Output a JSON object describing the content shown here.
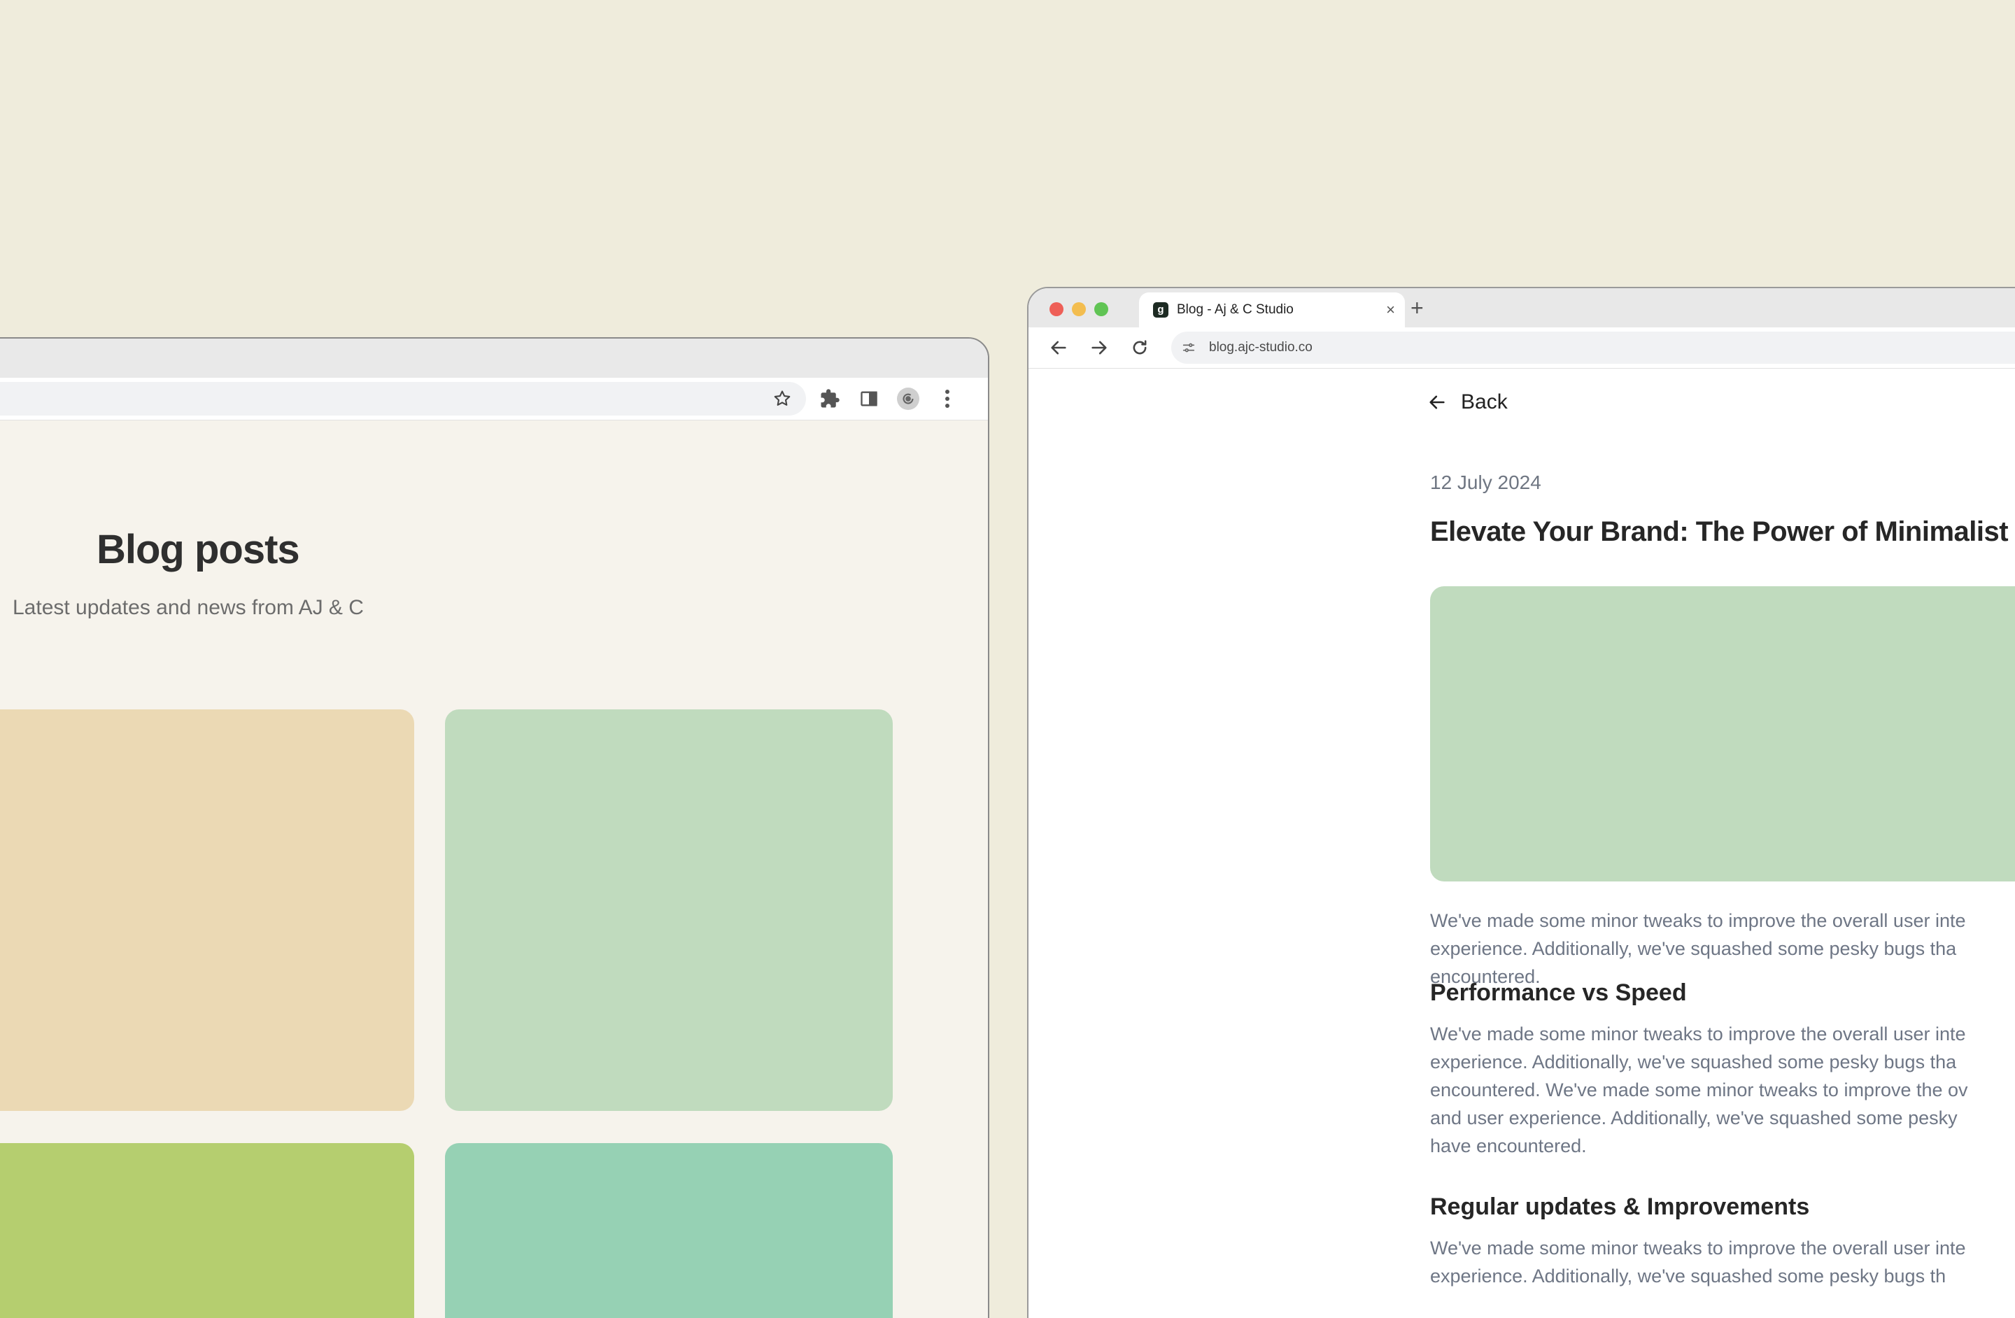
{
  "left_window": {
    "title": "Blog posts",
    "subtitle": "Latest updates and news from AJ & C",
    "cards": [
      {
        "name": "card-1",
        "color": "#ebd9b4"
      },
      {
        "name": "card-2",
        "color": "#c0dbbe"
      },
      {
        "name": "card-3",
        "color": "#b5ce6f"
      },
      {
        "name": "card-4",
        "color": "#96d1b4"
      }
    ],
    "toolbar": {
      "icons": [
        "star-icon",
        "extensions-icon",
        "side-panel-icon",
        "profile-avatar-icon",
        "kebab-menu-icon"
      ]
    }
  },
  "right_window": {
    "tab": {
      "title": "Blog - Aj & C Studio",
      "close_glyph": "×",
      "new_tab_glyph": "+"
    },
    "omnibox": {
      "url": "blog.ajc-studio.co"
    },
    "article": {
      "back_label": "Back",
      "date": "12 July 2024",
      "headline": "Elevate Your Brand: The Power of Minimalist D",
      "hero_color": "#c0dbbe",
      "paragraph_1": [
        "We've made some minor tweaks to improve the overall user inte",
        "experience. Additionally, we've squashed some pesky bugs tha",
        "encountered."
      ],
      "section_1_heading": "Performance vs Speed",
      "paragraph_2": [
        "We've made some minor tweaks to improve the overall user inte",
        "experience. Additionally, we've squashed some pesky bugs tha",
        "encountered. We've made some minor tweaks to improve the ov",
        "and user experience. Additionally, we've squashed some pesky",
        "have encountered."
      ],
      "section_2_heading": "Regular updates & Improvements",
      "paragraph_3": [
        "We've made some minor tweaks to improve the overall user inte",
        "experience. Additionally, we've squashed some pesky bugs th"
      ]
    }
  },
  "colors": {
    "background": "#efecdc",
    "left_page": "#f6f3ec",
    "body_text": "#6e7685",
    "heading_text": "#262626"
  }
}
